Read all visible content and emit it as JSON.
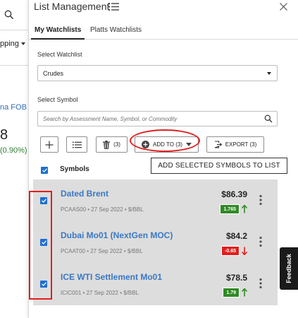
{
  "background_app": {
    "shipping_label": "pping",
    "fob_label": "na FOB I",
    "price_value": "8",
    "change_value": "(0.90%)"
  },
  "panel": {
    "title": "List Management",
    "title_icon": "list-icon",
    "close_icon": "close-icon",
    "tabs": [
      {
        "label": "My Watchlists",
        "active": true
      },
      {
        "label": "Platts Watchlists",
        "active": false
      }
    ],
    "select_watchlist_label": "Select Watchlist",
    "watchlist_value": "Crudes",
    "select_symbol_label": "Select Symbol",
    "search_placeholder": "Search by Assessment Name, Symbol, or Commodity"
  },
  "toolbar": {
    "add_icon": "plus-icon",
    "list_icon": "list-icon",
    "delete_count": "(3)",
    "add_to_label": "ADD TO (3)",
    "export_label": "EXPORT (3)"
  },
  "tooltip": "ADD SELECTED SYMBOLS TO LIST",
  "list_header": {
    "symbols_label": "Symbols",
    "all_checked": true
  },
  "rows": [
    {
      "name": "Dated Brent",
      "code": "PCAAS00",
      "date": "27 Sep 2022",
      "unit": "$/BBL",
      "price": "$86.39",
      "change": "1.765",
      "direction": "up",
      "checked": true
    },
    {
      "name": "Dubai Mo01 (NextGen MOC)",
      "code": "PCAAT00",
      "date": "27 Sep 2022",
      "unit": "$/BBL",
      "price": "$84.2",
      "change": "-0.65",
      "direction": "down",
      "checked": true
    },
    {
      "name": "ICE WTI Settlement Mo01",
      "code": "ICIC001",
      "date": "27 Sep 2022",
      "unit": "$/BBL",
      "price": "$78.5",
      "change": "1.79",
      "direction": "up",
      "checked": true
    }
  ],
  "feedback_label": "Feedback",
  "colors": {
    "link_blue": "#3a78c4",
    "checkbox_blue": "#1f6fd0",
    "up_green": "#2f8a25",
    "down_red": "#e01f1f",
    "annotation_red": "#e02020"
  }
}
